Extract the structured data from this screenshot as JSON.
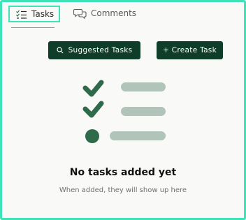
{
  "tabs": {
    "tasks_label": "Tasks",
    "comments_label": "Comments",
    "active": "Tasks"
  },
  "actions": {
    "suggested_tasks_label": "Suggested Tasks",
    "create_task_label": "+ Create Task"
  },
  "empty_state": {
    "title": "No tasks added yet",
    "subtitle": "When added, they will show up here"
  },
  "icons": {
    "tasks_tab": "checklist-icon",
    "comments_tab": "chat-bubbles-icon",
    "suggested": "search-icon"
  },
  "colors": {
    "accent_outline": "#3ee3b8",
    "button_bg": "#0f3d2a",
    "illustration_dark": "#2f6a4b",
    "illustration_light": "#b1c4b9"
  }
}
